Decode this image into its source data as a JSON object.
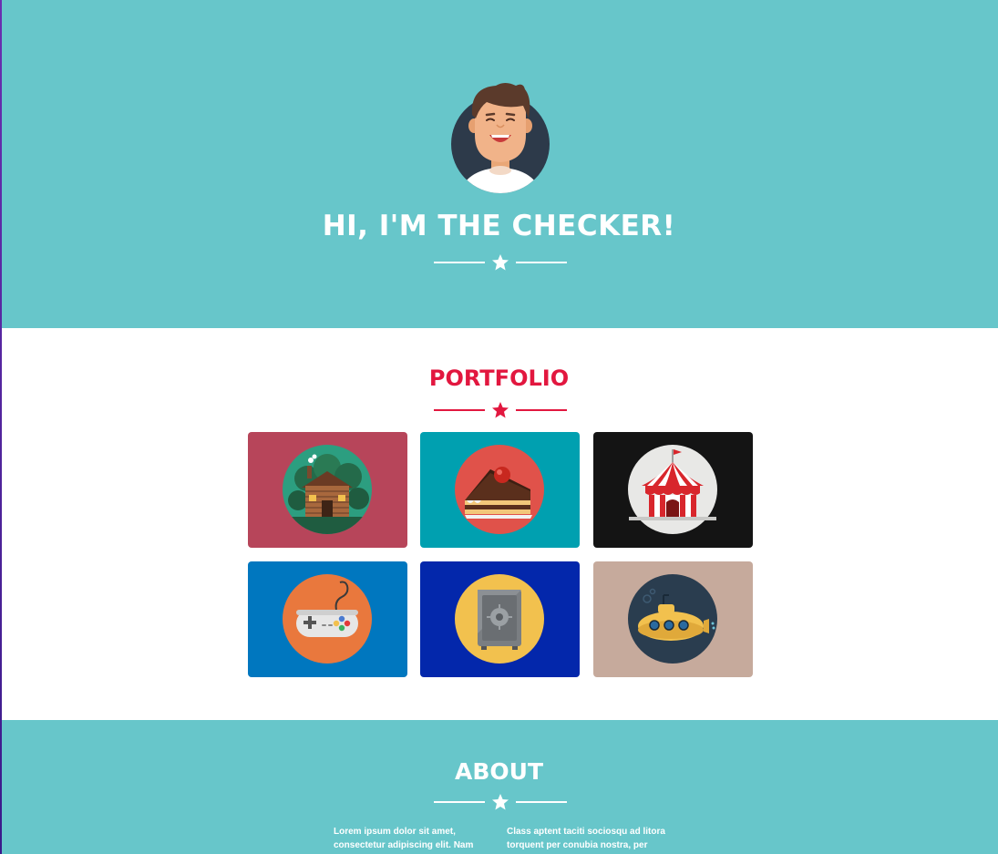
{
  "masthead": {
    "title": "HI, I'M THE CHECKER!"
  },
  "portfolio": {
    "title": "PORTFOLIO",
    "items": [
      {
        "icon": "cabin-icon",
        "bg": "#b7455a",
        "circle": "#2c9e80"
      },
      {
        "icon": "cake-icon",
        "bg": "#00a0b0",
        "circle": "#e0524a"
      },
      {
        "icon": "circus-tent-icon",
        "bg": "#141414",
        "circle": "#e8e8e6"
      },
      {
        "icon": "game-controller-icon",
        "bg": "#0077bf",
        "circle": "#e9783d"
      },
      {
        "icon": "safe-icon",
        "bg": "#0327ab",
        "circle": "#f2c14e"
      },
      {
        "icon": "submarine-icon",
        "bg": "#c6aa9c",
        "circle": "#2a3d4f"
      }
    ]
  },
  "about": {
    "title": "ABOUT",
    "col1": "Lorem ipsum dolor sit amet, consectetur adipiscing elit. Nam blandit turpis iaculis",
    "col2": "Class aptent taciti sociosqu ad litora torquent per conubia nostra, per"
  },
  "colors": {
    "teal": "#67c6ca",
    "accent_red": "#e2173f",
    "white": "#ffffff"
  }
}
